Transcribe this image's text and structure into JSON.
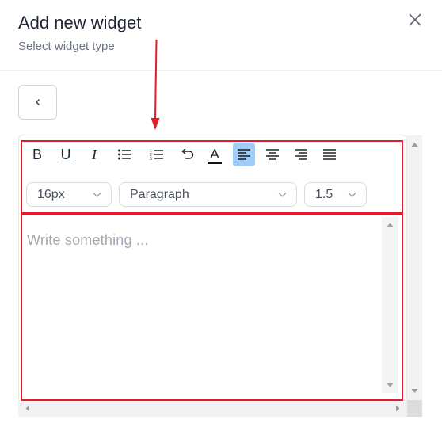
{
  "header": {
    "title": "Add new widget",
    "subtitle": "Select widget type"
  },
  "icons": {
    "close": "close-icon",
    "back": "chevron-left-icon"
  },
  "toolbar": {
    "bold": "B",
    "underline": "U",
    "italic": "I",
    "text_color_glyph": "A",
    "active_alignment": "align-left",
    "font_size": "16px",
    "block_format": "Paragraph",
    "line_height": "1.5"
  },
  "editor": {
    "placeholder": "Write something ..."
  },
  "colors": {
    "highlight_box": "#e11d2a",
    "active_button": "#9fcdf7",
    "arrow": "#e11d2a"
  }
}
